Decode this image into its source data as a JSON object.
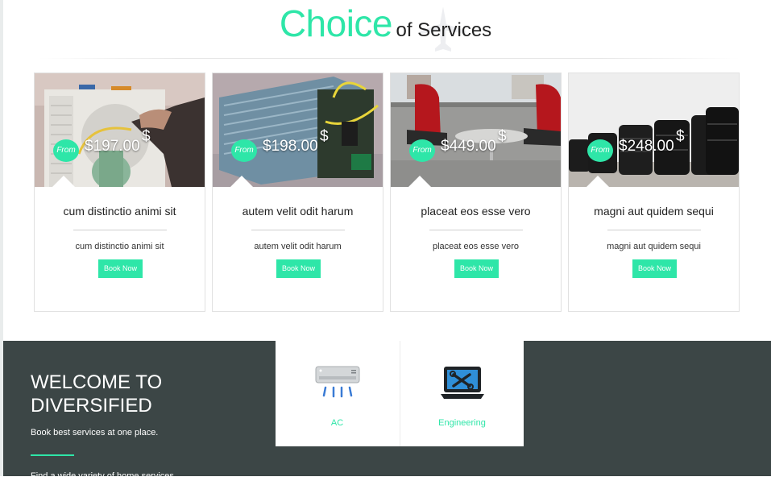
{
  "heading": {
    "highlight": "Choice",
    "rest": "of Services"
  },
  "cards": [
    {
      "from": "From",
      "price": "$197.00",
      "dollar": "$",
      "title": "cum distinctio animi sit",
      "subtitle": "cum distinctio animi sit",
      "button": "Book Now"
    },
    {
      "from": "From",
      "price": "$198.00",
      "dollar": "$",
      "title": "autem velit odit harum",
      "subtitle": "autem velit odit harum",
      "button": "Book Now"
    },
    {
      "from": "From",
      "price": "$449.00",
      "dollar": "$",
      "title": "placeat eos esse vero",
      "subtitle": "placeat eos esse vero",
      "button": "Book Now"
    },
    {
      "from": "From",
      "price": "$248.00",
      "dollar": "$",
      "title": "magni aut quidem sequi",
      "subtitle": "magni aut quidem sequi",
      "button": "Book Now"
    }
  ],
  "welcome": {
    "title_line1": "WELCOME TO",
    "title_line2": "DIVERSIFIED",
    "tagline": "Book best services at one place.",
    "cut_text": "Find a wide variety of home services"
  },
  "services": [
    {
      "label": "AC",
      "icon": "air-conditioner-icon"
    },
    {
      "label": "Engineering",
      "icon": "laptop-tools-icon"
    }
  ],
  "colors": {
    "accent": "#2ee6a8",
    "dark_band": "#3c4646"
  }
}
